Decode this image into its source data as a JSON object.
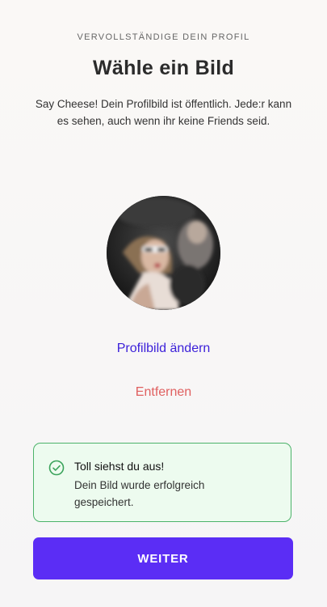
{
  "header": {
    "eyebrow": "VERVOLLSTÄNDIGE DEIN PROFIL",
    "title": "Wähle ein Bild",
    "description": "Say Cheese! Dein Profilbild ist öffentlich. Jede:r kann es sehen, auch wenn ihr keine Friends seid."
  },
  "profile": {
    "change_label": "Profilbild ändern",
    "remove_label": "Entfernen"
  },
  "toast": {
    "title": "Toll siehst du aus!",
    "message": "Dein Bild wurde erfolgreich gespeichert.",
    "icon": "check-circle-icon",
    "color": "#4cb36a"
  },
  "cta": {
    "label": "WEITER",
    "color": "#5b2df5"
  },
  "colors": {
    "link": "#3b1fd9",
    "danger": "#e06060"
  }
}
